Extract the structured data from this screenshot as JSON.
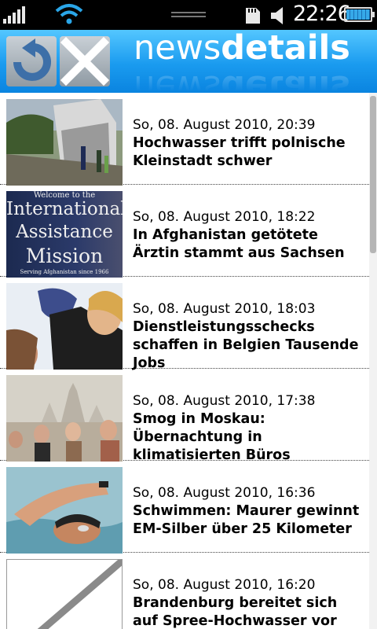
{
  "status_bar": {
    "time": "22:26",
    "icons": [
      "signal-icon",
      "wifi-icon",
      "sd-card-icon",
      "speaker-icon",
      "battery-icon"
    ]
  },
  "header": {
    "brand_light": "news",
    "brand_bold": "details",
    "back_icon": "rotate-back-icon",
    "close_icon": "close-icon",
    "accent_color": "#1a9bef"
  },
  "articles": [
    {
      "date": "So, 08. August 2010, 20:39",
      "title": "Hochwasser trifft polnische Kleinstadt schwer"
    },
    {
      "date": "So, 08. August 2010, 18:22",
      "title": "In Afghanistan getötete Ärztin stammt aus Sachsen"
    },
    {
      "date": "So, 08. August 2010, 18:03",
      "title": "Dienstleistungsschecks schaffen in Belgien Tausende Jobs"
    },
    {
      "date": "So, 08. August 2010, 17:38",
      "title": "Smog in Moskau: Übernachtung in klimatisierten Büros"
    },
    {
      "date": "So, 08. August 2010, 16:36",
      "title": "Schwimmen: Maurer gewinnt EM-Silber über 25 Kilometer"
    },
    {
      "date": "So, 08. August 2010, 16:20",
      "title": "Brandenburg bereitet sich auf Spree-Hochwasser vor"
    }
  ],
  "thumb_texts": {
    "mission_welcome": "Welcome to the",
    "mission_line1": "International",
    "mission_line2": "Assistance",
    "mission_line3": "Mission",
    "mission_footer": "Serving Afghanistan since 1966"
  }
}
